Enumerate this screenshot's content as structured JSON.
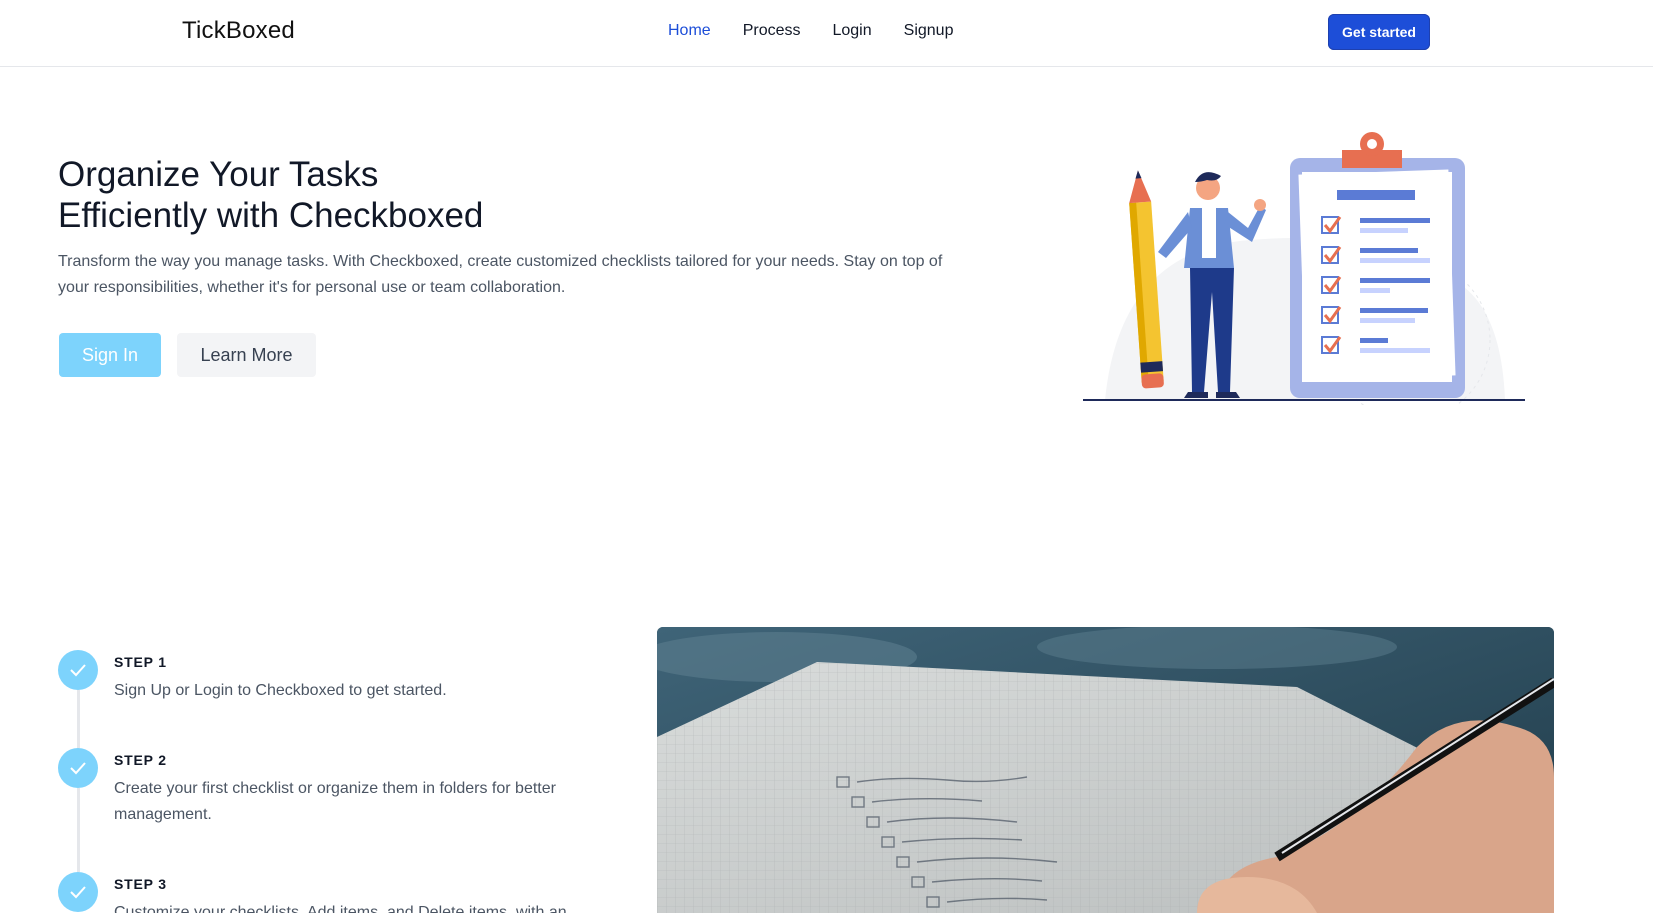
{
  "header": {
    "brand": "TickBoxed",
    "nav": [
      {
        "label": "Home",
        "active": true
      },
      {
        "label": "Process",
        "active": false
      },
      {
        "label": "Login",
        "active": false
      },
      {
        "label": "Signup",
        "active": false
      }
    ],
    "cta_label": "Get started"
  },
  "hero": {
    "title_line1": "Organize Your Tasks",
    "title_line2": "Efficiently with Checkboxed",
    "description": "Transform the way you manage tasks. With Checkboxed, create customized checklists tailored for your needs. Stay on top of your responsibilities, whether it's for personal use or team collaboration.",
    "primary_button": "Sign In",
    "secondary_button": "Learn More",
    "illustration_icon": "checklist-clipboard-illustration"
  },
  "steps": [
    {
      "label": "STEP 1",
      "text": "Sign Up or Login to Checkboxed to get started."
    },
    {
      "label": "STEP 2",
      "text": "Create your first checklist or organize them in folders for better management."
    },
    {
      "label": "STEP 3",
      "text": "Customize your checklists. Add items, and Delete items, with an"
    }
  ],
  "colors": {
    "accent": "#1d4ed8",
    "step_circle": "#7dd3fc",
    "signin_button": "#7dd3fc"
  }
}
